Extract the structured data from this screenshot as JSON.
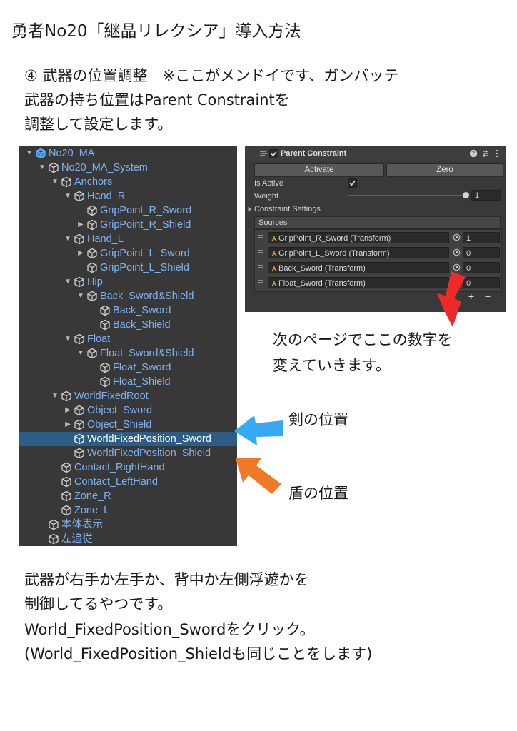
{
  "page": {
    "title": "勇者No20「継晶リレクシア」導入方法",
    "intro": [
      "④ 武器の位置調整　※ここがメンドイです、ガンバッテ",
      "武器の持ち位置はParent Constraintを",
      "調整して設定します。"
    ],
    "caption_numbers": [
      "次のページでここの数字を",
      "変えていきます。"
    ],
    "caption_sword": "剣の位置",
    "caption_shield": "盾の位置",
    "bottom": [
      "武器が右手か左手か、背中か左側浮遊かを",
      "制御してるやつです。",
      "World_FixedPosition_Swordをクリック。",
      "(World_FixedPosition_Shieldも同じことをします)"
    ]
  },
  "hierarchy": {
    "rows": [
      {
        "label": "No20_MA",
        "depth": 0,
        "arrow": "down",
        "prefab": true
      },
      {
        "label": "No20_MA_System",
        "depth": 1,
        "arrow": "down"
      },
      {
        "label": "Anchors",
        "depth": 2,
        "arrow": "down"
      },
      {
        "label": "Hand_R",
        "depth": 3,
        "arrow": "down"
      },
      {
        "label": "GripPoint_R_Sword",
        "depth": 4,
        "arrow": "none"
      },
      {
        "label": "GripPoint_R_Shield",
        "depth": 4,
        "arrow": "right"
      },
      {
        "label": "Hand_L",
        "depth": 3,
        "arrow": "down"
      },
      {
        "label": "GripPoint_L_Sword",
        "depth": 4,
        "arrow": "right"
      },
      {
        "label": "GripPoint_L_Shield",
        "depth": 4,
        "arrow": "none"
      },
      {
        "label": "Hip",
        "depth": 3,
        "arrow": "down"
      },
      {
        "label": "Back_Sword&Shield",
        "depth": 4,
        "arrow": "down"
      },
      {
        "label": "Back_Sword",
        "depth": 5,
        "arrow": "none"
      },
      {
        "label": "Back_Shield",
        "depth": 5,
        "arrow": "none"
      },
      {
        "label": "Float",
        "depth": 3,
        "arrow": "down"
      },
      {
        "label": "Float_Sword&Shield",
        "depth": 4,
        "arrow": "down"
      },
      {
        "label": "Float_Sword",
        "depth": 5,
        "arrow": "none"
      },
      {
        "label": "Float_Shield",
        "depth": 5,
        "arrow": "none"
      },
      {
        "label": "WorldFixedRoot",
        "depth": 2,
        "arrow": "down"
      },
      {
        "label": "Object_Sword",
        "depth": 3,
        "arrow": "right"
      },
      {
        "label": "Object_Shield",
        "depth": 3,
        "arrow": "right"
      },
      {
        "label": "WorldFixedPosition_Sword",
        "depth": 3,
        "arrow": "none",
        "selected": true
      },
      {
        "label": "WorldFixedPosition_Shield",
        "depth": 3,
        "arrow": "none"
      },
      {
        "label": "Contact_RightHand",
        "depth": 2,
        "arrow": "none"
      },
      {
        "label": "Contact_LeftHand",
        "depth": 2,
        "arrow": "none"
      },
      {
        "label": "Zone_R",
        "depth": 2,
        "arrow": "none"
      },
      {
        "label": "Zone_L",
        "depth": 2,
        "arrow": "none"
      },
      {
        "label": "本体表示",
        "depth": 1,
        "arrow": "none"
      },
      {
        "label": "左追従",
        "depth": 1,
        "arrow": "none"
      }
    ]
  },
  "inspector": {
    "component_title": "Parent Constraint",
    "activate_label": "Activate",
    "zero_label": "Zero",
    "is_active_label": "Is Active",
    "weight_label": "Weight",
    "weight_value": "1",
    "constraint_settings_label": "Constraint Settings",
    "sources_label": "Sources",
    "sources": [
      {
        "name": "GripPoint_R_Sword (Transform)",
        "weight": "1"
      },
      {
        "name": "GripPoint_L_Sword (Transform)",
        "weight": "0"
      },
      {
        "name": "Back_Sword (Transform)",
        "weight": "0"
      },
      {
        "name": "Float_Sword (Transform)",
        "weight": "0"
      }
    ],
    "add_label": "+",
    "remove_label": "−"
  },
  "colors": {
    "arrow_red": "#ee2a2a",
    "arrow_blue": "#36a9f2",
    "arrow_orange": "#f07a26",
    "hier_text": "#7fb3f5",
    "selection": "#2c5d87"
  }
}
